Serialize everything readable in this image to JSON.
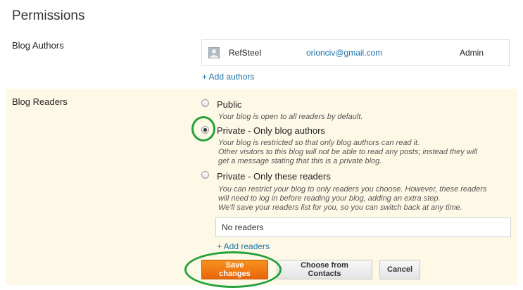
{
  "page": {
    "title": "Permissions"
  },
  "authors": {
    "label": "Blog Authors",
    "list": [
      {
        "name": "RefSteel",
        "email": "orionciv@gmail.com",
        "role": "Admin",
        "icon": "avatar-icon"
      }
    ],
    "add_link": "+ Add authors"
  },
  "readers": {
    "label": "Blog Readers",
    "selected": "private-authors",
    "options": [
      {
        "id": "public",
        "label": "Public",
        "checked": false,
        "description": [
          "Your blog is open to all readers by default."
        ]
      },
      {
        "id": "private-authors",
        "label": "Private - Only blog authors",
        "checked": true,
        "description": [
          "Your blog is restricted so that only blog authors can read it.",
          "Other visitors to this blog will not be able to read any posts; instead they will",
          "get a message stating that this is a private blog."
        ]
      },
      {
        "id": "private-readers",
        "label": "Private - Only these readers",
        "checked": false,
        "description": [
          "You can restrict your blog to only readers you choose. However, these readers",
          "will need to log in before reading your blog, adding an extra step.",
          "We'll save your readers list for you, so you can switch back at any time."
        ]
      }
    ],
    "input_value": "No readers",
    "add_link": "+ Add readers"
  },
  "buttons": {
    "save": "Save changes",
    "contacts": "Choose from Contacts",
    "cancel": "Cancel"
  },
  "colors": {
    "panel_background": "#fef9e6",
    "link": "#1a73a8",
    "save_button": "#f7931e",
    "highlight": "#23a33a"
  }
}
